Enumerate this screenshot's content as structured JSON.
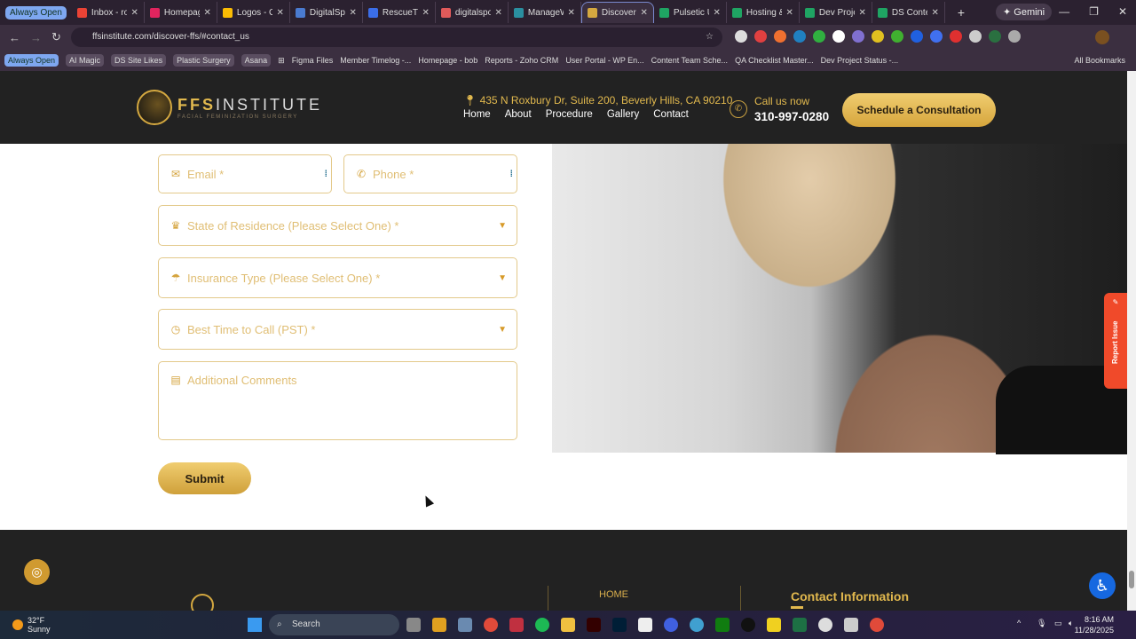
{
  "browser": {
    "always_open": "Always Open",
    "tabs": [
      {
        "label": "Inbox - ro",
        "color": "#ea4335"
      },
      {
        "label": "Homepag",
        "color": "#e0245e"
      },
      {
        "label": "Logos - G",
        "color": "#fbbc04"
      },
      {
        "label": "DigitalSp",
        "color": "#4a7bd0"
      },
      {
        "label": "RescueTi",
        "color": "#3b6ee8"
      },
      {
        "label": "digitalspo",
        "color": "#e05a5a"
      },
      {
        "label": "ManageW",
        "color": "#2a8fa0"
      },
      {
        "label": "Discover",
        "color": "#d4a840"
      },
      {
        "label": "Pulsetic U",
        "color": "#1fa463"
      },
      {
        "label": "Hosting &",
        "color": "#1fa463"
      },
      {
        "label": "Dev Proje",
        "color": "#1fa463"
      },
      {
        "label": "DS Conte",
        "color": "#1fa463"
      }
    ],
    "active_tab": 7,
    "gemini": "Gemini",
    "url": "ffsinstitute.com/discover-ffs/#contact_us",
    "bookmarks": [
      "Always Open",
      "AI Magic",
      "DS Site Likes",
      "Plastic Surgery",
      "Asana",
      "Figma Files",
      "Member Timelog -...",
      "Homepage - bob",
      "Reports - Zoho CRM",
      "User Portal - WP En...",
      "Content Team Sche...",
      "QA Checklist Master...",
      "Dev Project Status -..."
    ],
    "all_bookmarks": "All Bookmarks"
  },
  "header": {
    "brand_a": "FFS",
    "brand_b": "INSTITUTE",
    "tagline": "FACIAL FEMINIZATION SURGERY",
    "address": "435 N Roxbury Dr, Suite 200, Beverly Hills, CA 90210",
    "nav": [
      "Home",
      "About",
      "Procedure",
      "Gallery",
      "Contact"
    ],
    "call_label": "Call us now",
    "phone": "310-997-0280",
    "cta": "Schedule a Consultation"
  },
  "form": {
    "email": "Email *",
    "phone": "Phone *",
    "state": "State of Residence (Please Select One) *",
    "insurance": "Insurance Type (Please Select One) *",
    "best_time": "Best Time to Call (PST) *",
    "comments": "Additional Comments",
    "submit": "Submit"
  },
  "report_issue": "Report Issue",
  "footer": {
    "home": "HOME",
    "contact_title": "Contact Information"
  },
  "taskbar": {
    "temp": "32°F",
    "condition": "Sunny",
    "search": "Search",
    "time": "8:16 AM",
    "date": "11/28/2025"
  }
}
